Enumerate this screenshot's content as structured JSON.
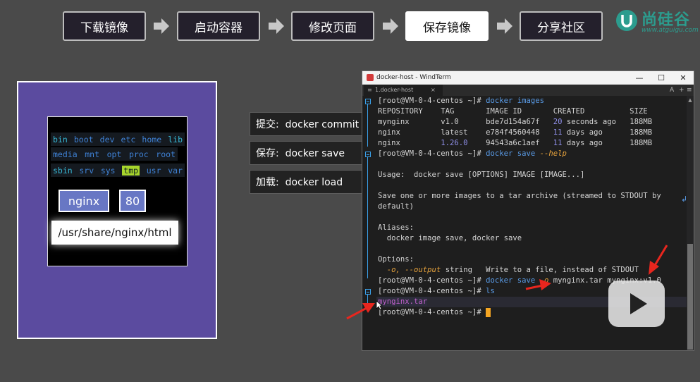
{
  "steps": [
    {
      "label": "下载镜像"
    },
    {
      "label": "启动容器"
    },
    {
      "label": "修改页面"
    },
    {
      "label": "保存镜像",
      "active": true
    },
    {
      "label": "分享社区"
    }
  ],
  "logo": {
    "text": "尚硅谷",
    "sub": "www.atguigu.com"
  },
  "illustration": {
    "dirs_row1": [
      "bin",
      "boot",
      "dev",
      "etc",
      "home",
      "lib"
    ],
    "dirs_row2": [
      "media",
      "mnt",
      "opt",
      "proc",
      "root"
    ],
    "dirs_row3": [
      "sbin",
      "srv",
      "sys",
      "tmp",
      "usr",
      "var"
    ],
    "highlighted_dir": "tmp",
    "nginx_label": "nginx",
    "port_label": "80",
    "path_label": "/usr/share/nginx/html"
  },
  "commands": [
    {
      "label": "提交:  docker commit"
    },
    {
      "label": "保存:  docker save"
    },
    {
      "label": "加载:  docker load"
    }
  ],
  "window": {
    "title": "docker-host - WindTerm",
    "tab_label": "1.docker-host",
    "tab_close": "×",
    "tab_right": [
      "A",
      "+",
      "≡"
    ],
    "min": "—",
    "max": "☐",
    "close": "✕"
  },
  "terminal": {
    "prompt": "[root@VM-0-4-centos ~]# ",
    "cmd_images": "docker images",
    "table_header": "REPOSITORY    TAG       IMAGE ID       CREATED          SIZE",
    "rows": [
      {
        "repo": "mynginx       ",
        "tag": "v1.0      ",
        "id": "bde7d154a67f   ",
        "num": "20",
        "created": " seconds ago   ",
        "size": "188MB"
      },
      {
        "repo": "nginx         ",
        "tag": "latest    ",
        "id": "e784f4560448   ",
        "num": "11",
        "created": " days ago      ",
        "size": "188MB"
      },
      {
        "repo": "nginx         ",
        "tag_num": "1.26.0",
        "tag_pad": "    ",
        "id": "94543a6c1aef   ",
        "num": "11",
        "created": " days ago      ",
        "size": "188MB"
      }
    ],
    "cmd_help_a": "docker save ",
    "cmd_help_b": "--help",
    "usage": "Usage:  docker save [OPTIONS] IMAGE [IMAGE...]",
    "desc1": "Save one or more images to a tar archive (streamed to STDOUT by",
    "desc2": "default)",
    "aliases_title": "Aliases:",
    "aliases": "  docker image save, docker save",
    "options_title": "Options:",
    "opt_flags": "-o, --output",
    "opt_type": " string   Write to a file, instead of STDOUT",
    "save_cmd_a": "docker save ",
    "save_cmd_flag": "-o",
    "save_cmd_b": " mynginx.tar mynginx:v1.0",
    "ls_cmd": "ls",
    "tar_file": "mynginx.tar"
  }
}
